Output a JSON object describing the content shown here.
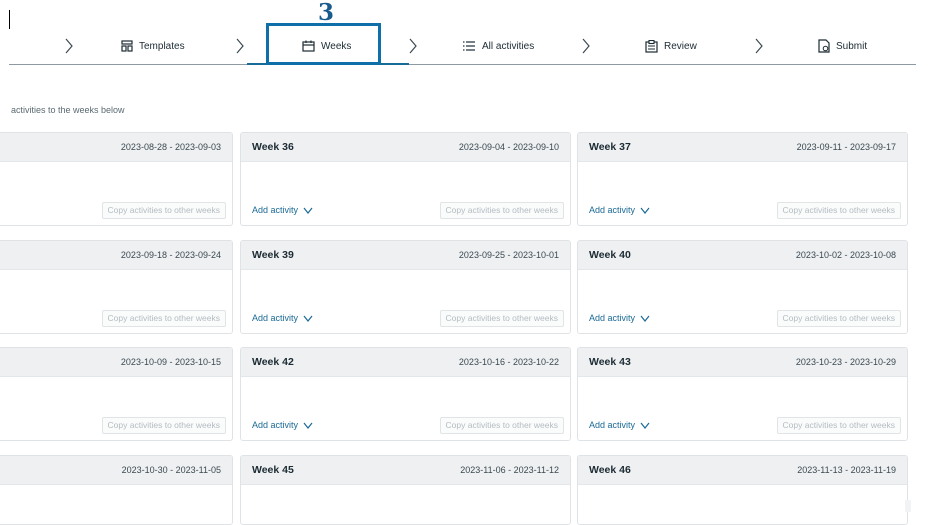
{
  "step_badge": "3",
  "nav": {
    "steps": [
      {
        "label": "Templates",
        "icon": "templates-icon"
      },
      {
        "label": "Weeks",
        "icon": "calendar-icon"
      },
      {
        "label": "All activities",
        "icon": "list-icon"
      },
      {
        "label": "Review",
        "icon": "review-icon"
      },
      {
        "label": "Submit",
        "icon": "submit-icon"
      }
    ],
    "active": "Weeks"
  },
  "instructions": "activities to the weeks below",
  "actions": {
    "add_activity": "Add activity",
    "copy_activities": "Copy activities to other weeks"
  },
  "rows": [
    [
      {
        "title": "",
        "range": "2023-08-28 - 2023-09-03"
      },
      {
        "title": "Week 36",
        "range": "2023-09-04 - 2023-09-10"
      },
      {
        "title": "Week 37",
        "range": "2023-09-11 - 2023-09-17"
      }
    ],
    [
      {
        "title": "",
        "range": "2023-09-18 - 2023-09-24"
      },
      {
        "title": "Week 39",
        "range": "2023-09-25 - 2023-10-01"
      },
      {
        "title": "Week 40",
        "range": "2023-10-02 - 2023-10-08"
      }
    ],
    [
      {
        "title": "",
        "range": "2023-10-09 - 2023-10-15"
      },
      {
        "title": "Week 42",
        "range": "2023-10-16 - 2023-10-22"
      },
      {
        "title": "Week 43",
        "range": "2023-10-23 - 2023-10-29"
      }
    ],
    [
      {
        "title": "",
        "range": "2023-10-30 - 2023-11-05"
      },
      {
        "title": "Week 45",
        "range": "2023-11-06 - 2023-11-12"
      },
      {
        "title": "Week 46",
        "range": "2023-11-13 - 2023-11-19"
      }
    ]
  ],
  "colors": {
    "accent": "#176b96",
    "highlight": "#0f6fa8",
    "header_bg": "#eef0f2"
  }
}
